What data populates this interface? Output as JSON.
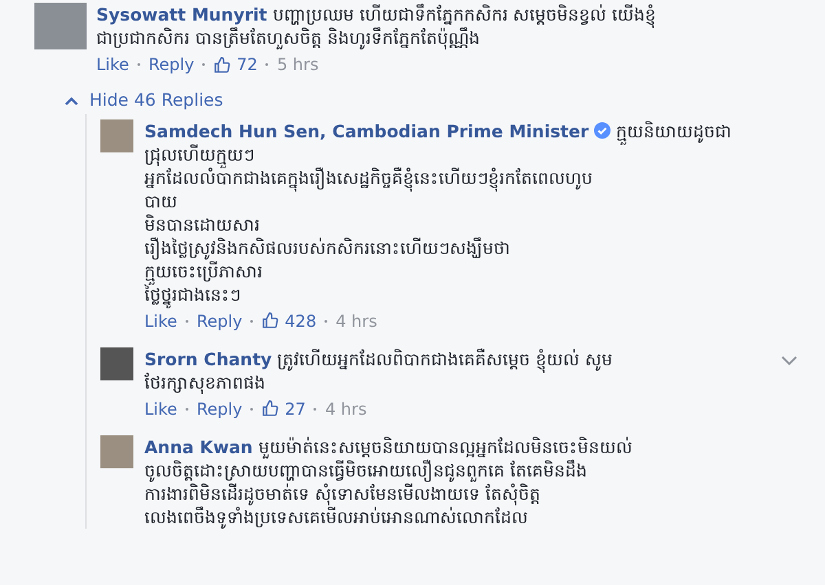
{
  "top_comment": {
    "author": "Sysowatt Munyrit",
    "lines": [
      "បញ្ហាប្រឈម ហើយជាទឹកភ្នែកកសិករ សម្តេចមិនខ្វល់ យើងខ្ញុំ",
      "ជាប្រជាកសិករ បានត្រឹមតែហួសចិត្ត និងហូរទឹកភ្នែកតែប៉ុណ្ណឹង"
    ],
    "like": "Like",
    "reply": "Reply",
    "likes": "72",
    "time": "5 hrs"
  },
  "replies_toggle": {
    "label": "Hide 46 Replies",
    "expanded": true
  },
  "replies": [
    {
      "author": "Samdech Hun Sen, Cambodian Prime Minister",
      "verified": true,
      "menu": false,
      "lines": [
        "ក្មួយនិយាយដូចជា",
        "ជ្រុលហើយក្មួយៗ",
        "អ្នកដែលលំបាកជាងគេក្នុងរឿងសេដ្ឋកិច្ចគឺខ្ញុំនេះហើយៗខ្ញុំរកតែពេលហូប",
        "បាយ",
        "មិនបានដោយសារ",
        "រឿងថ្លៃស្រូវនិងកសិផលរបស់កសិករនោះហើយៗសង្ឃឹមថា",
        "ក្មួយចេះប្រើភាសារ",
        "ថ្លៃថ្នូរជាងនេះៗ"
      ],
      "like": "Like",
      "reply": "Reply",
      "likes": "428",
      "time": "4 hrs"
    },
    {
      "author": "Srorn Chanty",
      "verified": false,
      "menu": true,
      "lines": [
        "ត្រូវហើយអ្នកដែលពិបាកជាងគេគឺសម្តេច ខ្ញុំយល់ សូម",
        "ថែរក្សាសុខភាពផង"
      ],
      "like": "Like",
      "reply": "Reply",
      "likes": "27",
      "time": "4 hrs"
    },
    {
      "author": "Anna Kwan",
      "verified": false,
      "menu": false,
      "lines": [
        "មួយម៉ាត់នេះសម្តេចនិយាយបានល្អអ្នកដែលមិនចេះមិនយល់",
        "ចូលចិត្តដោះស្រាយបញ្ហាបានធ្វើមិចអោយលឿនជូនពួកគេ តែគេមិនដឹង",
        "ការងារពិមិនដើរដូចមាត់ទេ សុំទោសមែនមើលងាយទេ តែសុំចិត្ត",
        "លេងពេចឹងទូទាំងប្រទេសគេមើលអាប់អោនណាស់លោកដែល"
      ]
    }
  ]
}
